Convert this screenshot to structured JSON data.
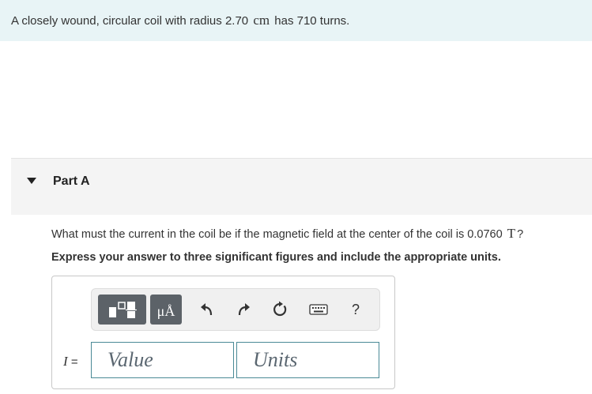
{
  "problem": {
    "intro_pre": "A closely wound, circular coil with radius 2.70",
    "intro_unit": "cm",
    "intro_post": "has 710 turns."
  },
  "part": {
    "title": "Part A",
    "question_pre": "What must the current in the coil be if the magnetic field at the center of the coil is 0.0760",
    "question_unit": "T",
    "question_post": "?",
    "instruction": "Express your answer to three significant figures and include the appropriate units."
  },
  "answer": {
    "variable": "I",
    "equals": "=",
    "value_placeholder": "Value",
    "units_placeholder": "Units"
  },
  "toolbar": {
    "units_button_label": "μÅ",
    "help_label": "?"
  },
  "colors": {
    "intro_bg": "#e8f4f6",
    "toolbar_button": "#5c6268",
    "field_border": "#4a8a96"
  }
}
